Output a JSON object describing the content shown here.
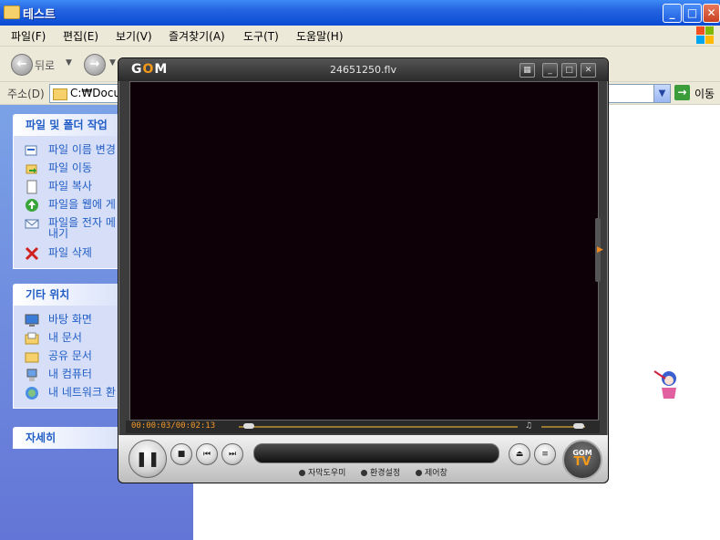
{
  "window": {
    "title": "테스트",
    "buttons": {
      "minimize": "_",
      "maximize": "□",
      "close": "✕"
    }
  },
  "menu": {
    "items": [
      "파일(F)",
      "편집(E)",
      "보기(V)",
      "즐겨찾기(A)",
      "도구(T)",
      "도움말(H)"
    ]
  },
  "toolbar": {
    "back_label": "뒤로"
  },
  "address": {
    "label": "주소(D)",
    "value": "C:₩Docu",
    "go_label": "이동"
  },
  "sidepane": {
    "panels": [
      {
        "title": "파일 및 폴더 작업",
        "items": [
          {
            "label": "파일 이름 변경",
            "icon": "rename-icon"
          },
          {
            "label": "파일 이동",
            "icon": "move-icon"
          },
          {
            "label": "파일 복사",
            "icon": "copy-icon"
          },
          {
            "label": "파일을 웹에 게",
            "icon": "web-publish-icon"
          },
          {
            "label": "파일을 전자 메",
            "label2": "내기",
            "icon": "email-icon"
          },
          {
            "label": "파일 삭제",
            "icon": "delete-icon"
          }
        ]
      },
      {
        "title": "기타 위치",
        "items": [
          {
            "label": "바탕 화면",
            "icon": "desktop-icon"
          },
          {
            "label": "내 문서",
            "icon": "my-documents-icon"
          },
          {
            "label": "공유 문서",
            "icon": "shared-documents-icon"
          },
          {
            "label": "내 컴퓨터",
            "icon": "my-computer-icon"
          },
          {
            "label": "내 네트워크 환",
            "icon": "network-icon"
          }
        ]
      },
      {
        "title": "자세히",
        "items": []
      }
    ]
  },
  "player": {
    "logo_text": "GOM",
    "filename": "24651250.flv",
    "time": "00:00:03/00:02:13",
    "progress": 0.023,
    "volume": 0.85,
    "logo_badge_top": "GOM",
    "logo_badge_bottom": "TV",
    "links": [
      "자막도우미",
      "환경설정",
      "제어창"
    ],
    "accent": "#f39a1a"
  }
}
